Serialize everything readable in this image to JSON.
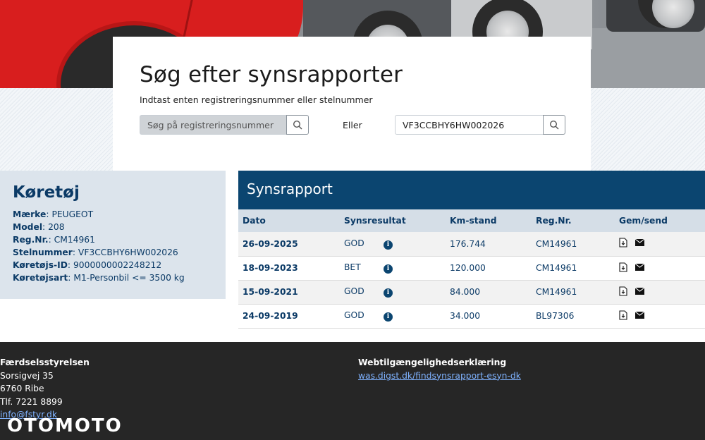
{
  "search": {
    "title": "Søg efter synsrapporter",
    "subtitle": "Indtast enten registreringsnummer eller stelnummer",
    "reg_placeholder": "Søg på registreringsnummer",
    "or_label": "Eller",
    "vin_value": "VF3CCBHY6HW002026"
  },
  "vehicle": {
    "heading": "Køretøj",
    "rows": [
      {
        "label": "Mærke",
        "value": "PEUGEOT"
      },
      {
        "label": "Model",
        "value": "208"
      },
      {
        "label": "Reg.Nr.",
        "value": "CM14961"
      },
      {
        "label": "Stelnummer",
        "value": "VF3CCBHY6HW002026"
      },
      {
        "label": "Køretøjs-ID",
        "value": "9000000002248212"
      },
      {
        "label": "Køretøjsart",
        "value": "M1-Personbil <= 3500 kg"
      }
    ]
  },
  "report": {
    "heading": "Synsrapport",
    "columns": [
      "Dato",
      "Synsresultat",
      "Km-stand",
      "Reg.Nr.",
      "Gem/send"
    ],
    "rows": [
      {
        "date": "26-09-2025",
        "result": "GOD",
        "km": "176.744",
        "reg": "CM14961"
      },
      {
        "date": "18-09-2023",
        "result": "BET",
        "km": "120.000",
        "reg": "CM14961"
      },
      {
        "date": "15-09-2021",
        "result": "GOD",
        "km": "84.000",
        "reg": "CM14961"
      },
      {
        "date": "24-09-2019",
        "result": "GOD",
        "km": "34.000",
        "reg": "BL97306"
      }
    ]
  },
  "footer": {
    "org": "Færdselsstyrelsen",
    "address1": "Sorsigvej 35",
    "address2": "6760 Ribe",
    "phone": "Tlf. 7221 8899",
    "email": "info@fstyr.dk",
    "a11y_heading": "Webtilgængelighedserklæring",
    "a11y_link": "was.digst.dk/findsynsrapport-esyn-dk"
  },
  "watermark": "OTOMOTO",
  "icons": {
    "search": "search-icon",
    "info": "info-icon",
    "download": "download-icon",
    "mail": "mail-icon"
  },
  "colors": {
    "primary": "#0b4570",
    "text_primary": "#0b3a66",
    "vehicle_bg": "#dce4ec",
    "footer_bg": "#262626",
    "link": "#7fb2ff"
  }
}
